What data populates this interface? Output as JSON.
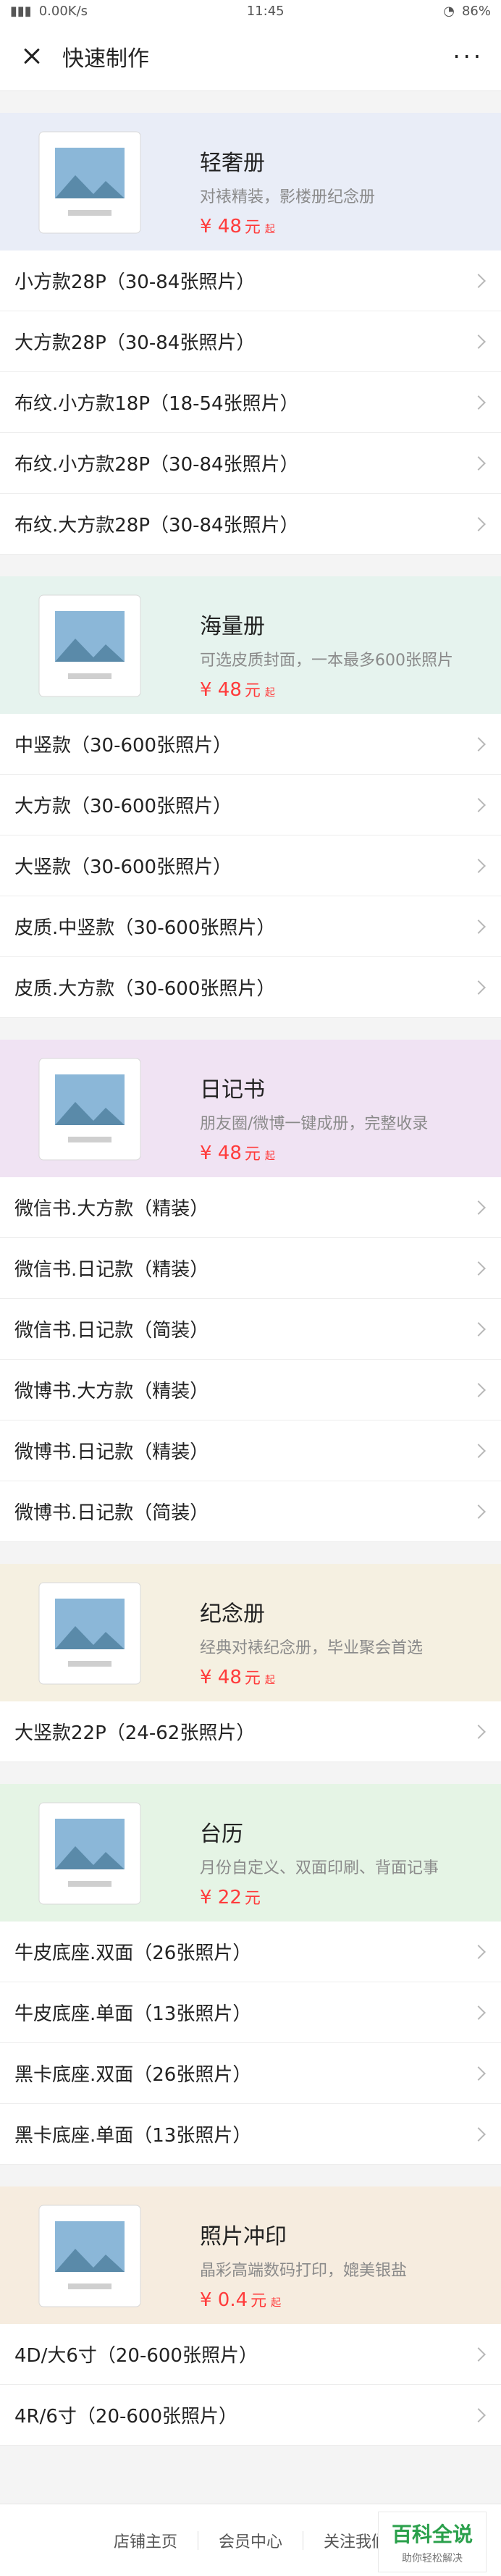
{
  "status_bar": {
    "speed": "0.00K/s",
    "time": "11:45",
    "battery": "86%"
  },
  "header": {
    "title": "快速制作",
    "more": "···"
  },
  "sections": [
    {
      "title": "轻奢册",
      "subtitle": "对裱精装，影楼册纪念册",
      "price": "¥ 48",
      "unit": "元",
      "qi": "起",
      "bg": "#e9edf7",
      "items": [
        "小方款28P（30-84张照片）",
        "大方款28P（30-84张照片）",
        "布纹.小方款18P（18-54张照片）",
        "布纹.小方款28P（30-84张照片）",
        "布纹.大方款28P（30-84张照片）"
      ]
    },
    {
      "title": "海量册",
      "subtitle": "可选皮质封面，一本最多600张照片",
      "price": "¥ 48",
      "unit": "元",
      "qi": "起",
      "bg": "#e6f3ee",
      "items": [
        "中竖款（30-600张照片）",
        "大方款（30-600张照片）",
        "大竖款（30-600张照片）",
        "皮质.中竖款（30-600张照片）",
        "皮质.大方款（30-600张照片）"
      ]
    },
    {
      "title": "日记书",
      "subtitle": "朋友圈/微博一键成册，完整收录",
      "price": "¥ 48",
      "unit": "元",
      "qi": "起",
      "bg": "#f0e3f3",
      "items": [
        "微信书.大方款（精装）",
        "微信书.日记款（精装）",
        "微信书.日记款（简装）",
        "微博书.大方款（精装）",
        "微博书.日记款（精装）",
        "微博书.日记款（简装）"
      ]
    },
    {
      "title": "纪念册",
      "subtitle": "经典对裱纪念册，毕业聚会首选",
      "price": "¥ 48",
      "unit": "元",
      "qi": "起",
      "bg": "#f5f0e1",
      "items": [
        "大竖款22P（24-62张照片）"
      ]
    },
    {
      "title": "台历",
      "subtitle": "月份自定义、双面印刷、背面记事",
      "price": "¥ 22",
      "unit": "元",
      "qi": "",
      "bg": "#e5f4e5",
      "items": [
        "牛皮底座.双面（26张照片）",
        "牛皮底座.单面（13张照片）",
        "黑卡底座.双面（26张照片）",
        "黑卡底座.单面（13张照片）"
      ]
    },
    {
      "title": "照片冲印",
      "subtitle": "晶彩高端数码打印，媲美银盐",
      "price": "¥ 0.4",
      "unit": "元",
      "qi": "起",
      "bg": "#f6ecdf",
      "items": [
        "4D/大6寸（20-600张照片）",
        "4R/6寸（20-600张照片）"
      ]
    }
  ],
  "footer": {
    "links": [
      "店铺主页",
      "会员中心",
      "关注我们"
    ],
    "watermark_title": "百科全说",
    "watermark_sub": "助你轻松解决"
  }
}
